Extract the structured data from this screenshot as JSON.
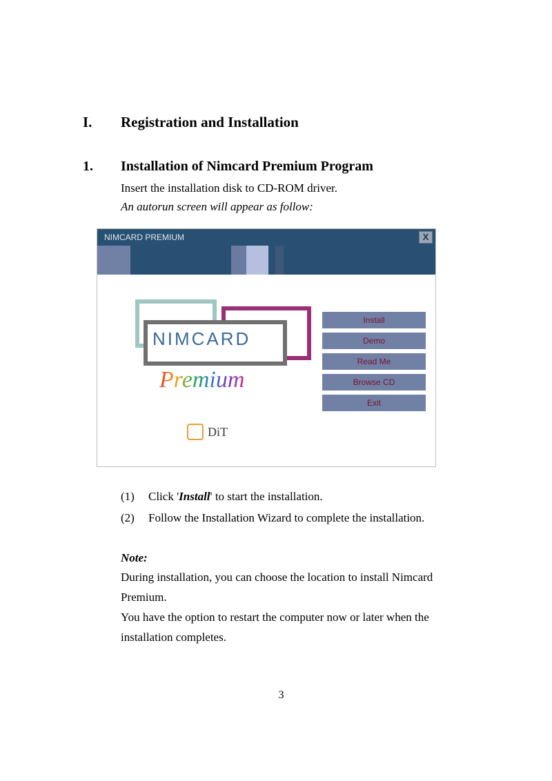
{
  "headings": {
    "section_num": "I.",
    "section_title": "Registration and Installation",
    "sub_num": "1.",
    "sub_title": "Installation of Nimcard Premium Program"
  },
  "intro": {
    "line1": "Insert the installation disk to CD-ROM driver.",
    "line2": "An autorun screen will appear as follow:"
  },
  "dialog": {
    "title": "NIMCARD PREMIUM",
    "close": "X",
    "logo_brand": "NIMCARD",
    "logo_tag": "Premium",
    "footer_brand": "DiT",
    "menu": [
      "Install",
      "Demo",
      "Read Me",
      "Browse CD",
      "Exit"
    ]
  },
  "steps": {
    "s1_num": "(1)",
    "s1_pre": "Click '",
    "s1_bold": "Install",
    "s1_post": "' to start the installation.",
    "s2_num": "(2)",
    "s2_text": "Follow the Installation Wizard to complete the installation."
  },
  "note": {
    "label": "Note:",
    "p1": "During installation, you can choose the location to install Nimcard Premium.",
    "p2": "You have the option to restart the computer now or later when the installation completes."
  },
  "page_number": "3"
}
